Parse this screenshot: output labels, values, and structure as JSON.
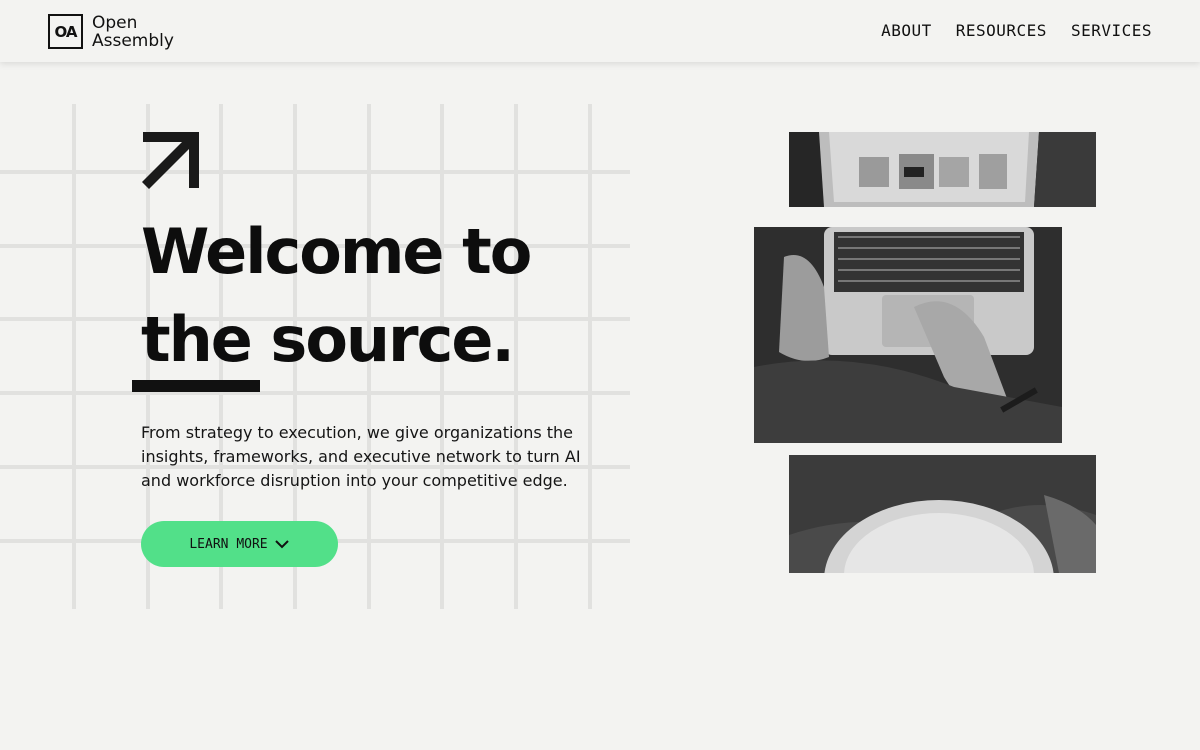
{
  "header": {
    "logo_mark": "OA",
    "logo_line1": "Open",
    "logo_line2": "Assembly",
    "nav": [
      {
        "label": "ABOUT"
      },
      {
        "label": "RESOURCES"
      },
      {
        "label": "SERVICES"
      }
    ]
  },
  "hero": {
    "headline_line1": "Welcome to",
    "headline_under": "the",
    "headline_line2_rest": " source.",
    "description": "From strategy to execution, we give organizations the insights, frameworks, and executive network to turn AI and workforce disruption into your competitive edge.",
    "cta_label": "LEARN MORE"
  },
  "colors": {
    "background": "#f3f3f1",
    "accent": "#52e089",
    "text": "#111111"
  },
  "icons": {
    "arrow": "arrow-up-right-icon",
    "chevron": "chevron-down-icon"
  }
}
